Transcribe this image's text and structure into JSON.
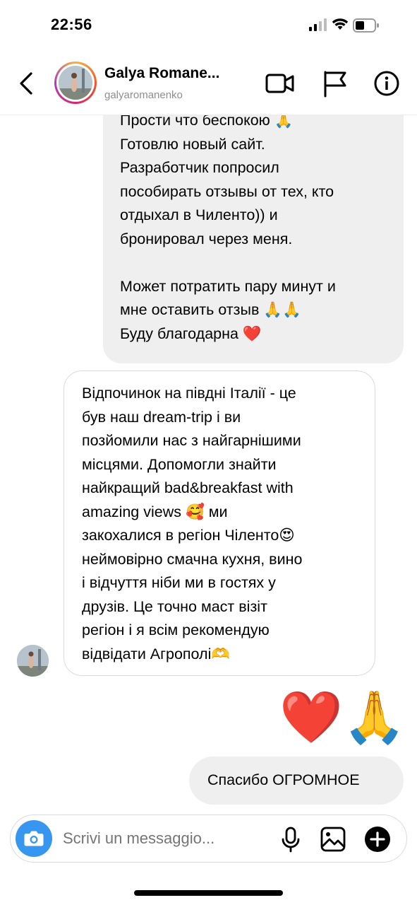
{
  "status_bar": {
    "time": "22:56"
  },
  "header": {
    "name": "Galya Romane...",
    "handle": "galyaromanenko"
  },
  "messages": {
    "outgoing_long": [
      "Прости что беспокою 🙏",
      "Готовлю новый сайт.",
      "Разработчик попросил",
      "пособирать отзывы от тех, кто",
      "отдыхал в Чиленто)) и",
      "бронировал через меня.",
      "",
      "Может потратить пару минут и",
      "мне оставить отзыв 🙏🙏",
      "Буду благодарна ❤️"
    ],
    "incoming": [
      "Відпочинок на півдні Італії - це",
      "був наш dream-trip і ви",
      "позйомили нас з найгарнішими",
      "місцями. Допомогли знайти",
      "найкращий bad&breakfast with",
      "amazing views 🥰 ми",
      "закохалися в регіон Чіленто😍",
      "неймовірно смачна кухня, вино",
      "і відчуття ніби ми в гостях у",
      "друзів. Це точно маст візіт",
      "регіон і я всім рекомендую",
      "відвідати Агрополі🫶"
    ],
    "emoji_reply": "❤️🙏",
    "outgoing_short": "Спасибо ОГРОМНОЕ"
  },
  "composer": {
    "placeholder": "Scrivi un messaggio..."
  },
  "icons": {
    "back": "chevron-left-icon",
    "video": "video-camera-icon",
    "flag": "flag-icon",
    "info": "info-icon",
    "camera": "camera-icon",
    "mic": "microphone-icon",
    "gallery": "image-icon",
    "plus": "plus-icon"
  },
  "colors": {
    "accent": "#3797f0",
    "bubble_grey": "#efefef",
    "border": "#dbdbdb",
    "secondary_text": "#8e8e8e"
  }
}
